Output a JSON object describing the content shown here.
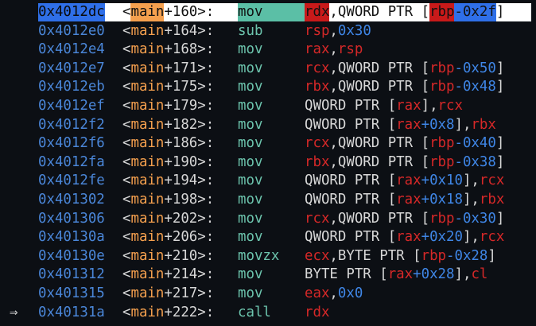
{
  "current_marker": "⇒",
  "rows": [
    {
      "addr": "0x4012dc",
      "sym": "main",
      "off": "+160",
      "mnem": "mov",
      "ops": [
        [
          "reg",
          "rdx"
        ],
        [
          "txt",
          ",QWORD PTR ["
        ],
        [
          "reg",
          "rbp"
        ],
        [
          "num",
          "-0x2f"
        ],
        [
          "txt",
          "]"
        ]
      ]
    },
    {
      "addr": "0x4012e0",
      "sym": "main",
      "off": "+164",
      "mnem": "sub",
      "ops": [
        [
          "reg",
          "rsp"
        ],
        [
          "txt",
          ","
        ],
        [
          "num",
          "0x30"
        ]
      ]
    },
    {
      "addr": "0x4012e4",
      "sym": "main",
      "off": "+168",
      "mnem": "mov",
      "ops": [
        [
          "reg",
          "rax"
        ],
        [
          "txt",
          ","
        ],
        [
          "reg",
          "rsp"
        ]
      ]
    },
    {
      "addr": "0x4012e7",
      "sym": "main",
      "off": "+171",
      "mnem": "mov",
      "ops": [
        [
          "reg",
          "rcx"
        ],
        [
          "txt",
          ",QWORD PTR ["
        ],
        [
          "reg",
          "rbp"
        ],
        [
          "num",
          "-0x50"
        ],
        [
          "txt",
          "]"
        ]
      ]
    },
    {
      "addr": "0x4012eb",
      "sym": "main",
      "off": "+175",
      "mnem": "mov",
      "ops": [
        [
          "reg",
          "rbx"
        ],
        [
          "txt",
          ",QWORD PTR ["
        ],
        [
          "reg",
          "rbp"
        ],
        [
          "num",
          "-0x48"
        ],
        [
          "txt",
          "]"
        ]
      ]
    },
    {
      "addr": "0x4012ef",
      "sym": "main",
      "off": "+179",
      "mnem": "mov",
      "ops": [
        [
          "txt",
          "QWORD PTR ["
        ],
        [
          "reg",
          "rax"
        ],
        [
          "txt",
          "],"
        ],
        [
          "reg",
          "rcx"
        ]
      ]
    },
    {
      "addr": "0x4012f2",
      "sym": "main",
      "off": "+182",
      "mnem": "mov",
      "ops": [
        [
          "txt",
          "QWORD PTR ["
        ],
        [
          "reg",
          "rax"
        ],
        [
          "num",
          "+0x8"
        ],
        [
          "txt",
          "],"
        ],
        [
          "reg",
          "rbx"
        ]
      ]
    },
    {
      "addr": "0x4012f6",
      "sym": "main",
      "off": "+186",
      "mnem": "mov",
      "ops": [
        [
          "reg",
          "rcx"
        ],
        [
          "txt",
          ",QWORD PTR ["
        ],
        [
          "reg",
          "rbp"
        ],
        [
          "num",
          "-0x40"
        ],
        [
          "txt",
          "]"
        ]
      ]
    },
    {
      "addr": "0x4012fa",
      "sym": "main",
      "off": "+190",
      "mnem": "mov",
      "ops": [
        [
          "reg",
          "rbx"
        ],
        [
          "txt",
          ",QWORD PTR ["
        ],
        [
          "reg",
          "rbp"
        ],
        [
          "num",
          "-0x38"
        ],
        [
          "txt",
          "]"
        ]
      ]
    },
    {
      "addr": "0x4012fe",
      "sym": "main",
      "off": "+194",
      "mnem": "mov",
      "ops": [
        [
          "txt",
          "QWORD PTR ["
        ],
        [
          "reg",
          "rax"
        ],
        [
          "num",
          "+0x10"
        ],
        [
          "txt",
          "],"
        ],
        [
          "reg",
          "rcx"
        ]
      ]
    },
    {
      "addr": "0x401302",
      "sym": "main",
      "off": "+198",
      "mnem": "mov",
      "ops": [
        [
          "txt",
          "QWORD PTR ["
        ],
        [
          "reg",
          "rax"
        ],
        [
          "num",
          "+0x18"
        ],
        [
          "txt",
          "],"
        ],
        [
          "reg",
          "rbx"
        ]
      ]
    },
    {
      "addr": "0x401306",
      "sym": "main",
      "off": "+202",
      "mnem": "mov",
      "ops": [
        [
          "reg",
          "rcx"
        ],
        [
          "txt",
          ",QWORD PTR ["
        ],
        [
          "reg",
          "rbp"
        ],
        [
          "num",
          "-0x30"
        ],
        [
          "txt",
          "]"
        ]
      ]
    },
    {
      "addr": "0x40130a",
      "sym": "main",
      "off": "+206",
      "mnem": "mov",
      "ops": [
        [
          "txt",
          "QWORD PTR ["
        ],
        [
          "reg",
          "rax"
        ],
        [
          "num",
          "+0x20"
        ],
        [
          "txt",
          "],"
        ],
        [
          "reg",
          "rcx"
        ]
      ]
    },
    {
      "addr": "0x40130e",
      "sym": "main",
      "off": "+210",
      "mnem": "movzx",
      "ops": [
        [
          "reg",
          "ecx"
        ],
        [
          "txt",
          ",BYTE PTR ["
        ],
        [
          "reg",
          "rbp"
        ],
        [
          "num",
          "-0x28"
        ],
        [
          "txt",
          "]"
        ]
      ]
    },
    {
      "addr": "0x401312",
      "sym": "main",
      "off": "+214",
      "mnem": "mov",
      "ops": [
        [
          "txt",
          "BYTE PTR ["
        ],
        [
          "reg",
          "rax"
        ],
        [
          "num",
          "+0x28"
        ],
        [
          "txt",
          "],"
        ],
        [
          "reg",
          "cl"
        ]
      ]
    },
    {
      "addr": "0x401315",
      "sym": "main",
      "off": "+217",
      "mnem": "mov",
      "ops": [
        [
          "reg",
          "eax"
        ],
        [
          "txt",
          ","
        ],
        [
          "num",
          "0x0"
        ]
      ]
    },
    {
      "addr": "0x40131a",
      "sym": "main",
      "off": "+222",
      "mnem": "call",
      "ops": [
        [
          "reg",
          "rdx"
        ]
      ]
    }
  ],
  "selected_index": 0,
  "current_index": 16
}
